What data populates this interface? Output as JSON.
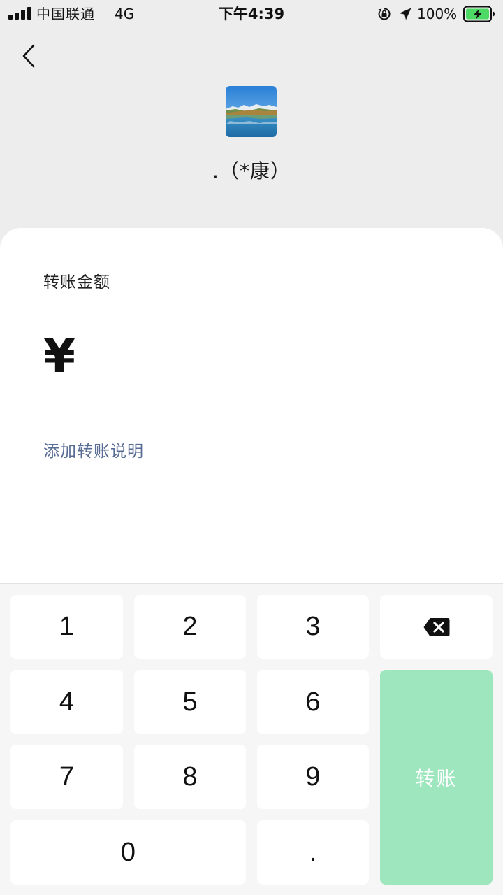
{
  "status_bar": {
    "carrier": "中国联通",
    "network": "4G",
    "time": "下午4:39",
    "battery_percent": "100%",
    "signal_bars": 4
  },
  "header": {
    "back_icon": "chevron-left-icon",
    "payee_name": ".（*康）"
  },
  "form": {
    "amount_label": "转账金额",
    "currency_symbol": "¥",
    "amount_value": "",
    "add_note_label": "添加转账说明"
  },
  "keypad": {
    "keys": [
      "1",
      "2",
      "3",
      "4",
      "5",
      "6",
      "7",
      "8",
      "9",
      "0",
      "."
    ],
    "delete_icon": "backspace-icon",
    "transfer_label": "转账"
  },
  "colors": {
    "page_background": "#ededed",
    "link": "#576b95",
    "transfer_button": "#9de6be",
    "battery_charging": "#4cd964"
  }
}
